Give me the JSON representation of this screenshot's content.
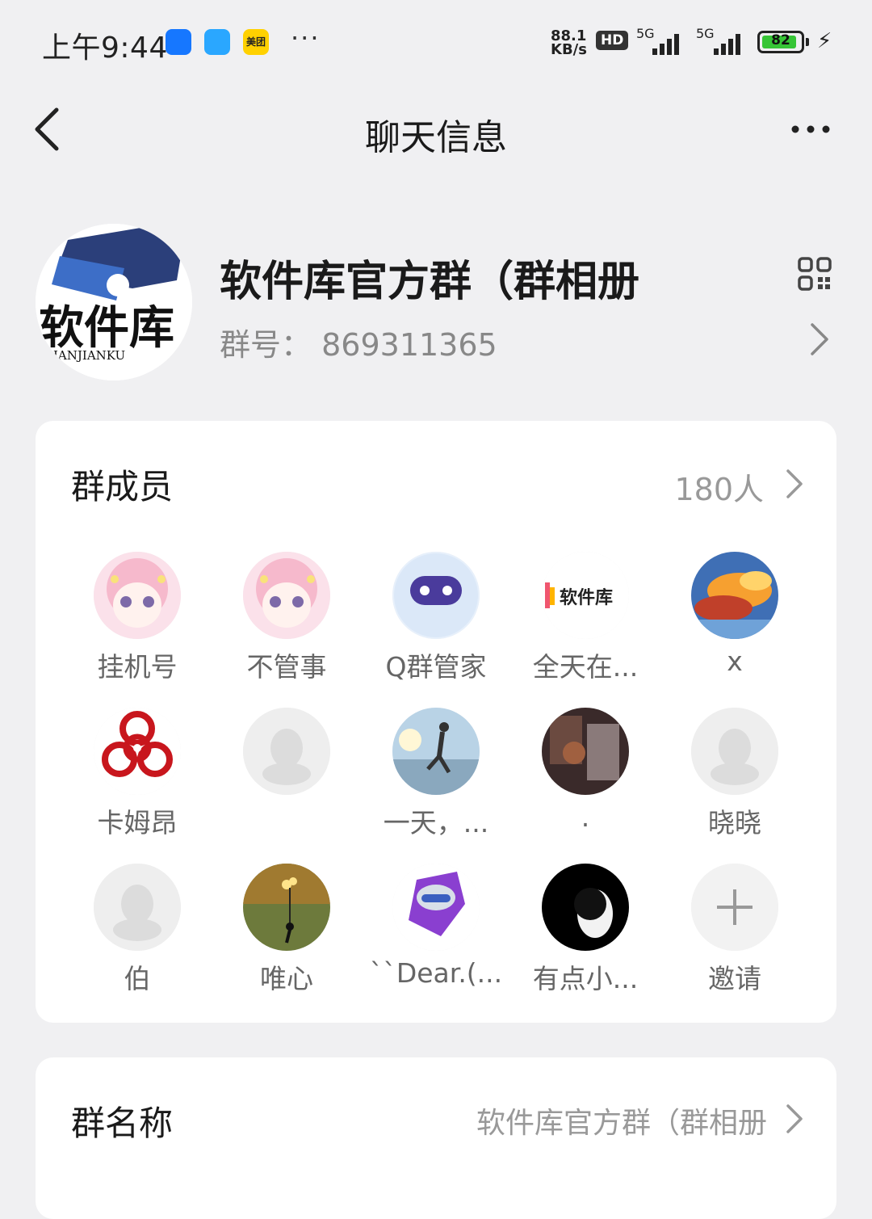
{
  "status_bar": {
    "time": "上午9:44",
    "app_badge_3": "美团",
    "more": "···",
    "speed_line1": "88.1",
    "speed_line2": "KB/s",
    "hd": "HD",
    "net1": "5G",
    "net2": "5G",
    "battery": "82"
  },
  "nav": {
    "title": "聊天信息"
  },
  "group": {
    "name": "软件库官方群（群相册",
    "id_label": "群号：",
    "id_value": "869311365",
    "avatar_text": "软件库",
    "avatar_subtext": "IANJIANKU"
  },
  "members_section": {
    "title": "群成员",
    "count": "180人",
    "members": [
      {
        "name": "挂机号",
        "avatar": "anime-girl-avatar"
      },
      {
        "name": "不管事",
        "avatar": "anime-girl-avatar"
      },
      {
        "name": "Q群管家",
        "avatar": "robot-avatar"
      },
      {
        "name": "全天在...",
        "avatar": "ruanjianku-logo-avatar",
        "logo_text": "软件库"
      },
      {
        "name": "x",
        "avatar": "sky-clouds-avatar"
      },
      {
        "name": "卡姆昂",
        "avatar": "biohazard-avatar"
      },
      {
        "name": "",
        "avatar": "default-penguin-avatar"
      },
      {
        "name": "一天，...",
        "avatar": "jumping-person-avatar"
      },
      {
        "name": ".",
        "avatar": "photo-avatar"
      },
      {
        "name": "晓晓",
        "avatar": "default-penguin-avatar"
      },
      {
        "name": "伯",
        "avatar": "default-penguin-avatar"
      },
      {
        "name": "唯心",
        "avatar": "balloon-avatar"
      },
      {
        "name": "``Dear.(...",
        "avatar": "cartoon-avatar"
      },
      {
        "name": "有点小...",
        "avatar": "dark-hood-avatar"
      },
      {
        "name": "邀请",
        "avatar": "plus-icon"
      }
    ]
  },
  "group_name_section": {
    "title": "群名称",
    "value": "软件库官方群（群相册"
  }
}
